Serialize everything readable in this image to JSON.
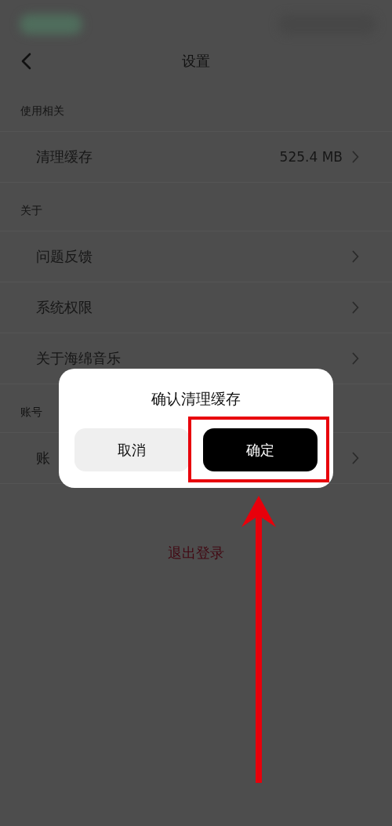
{
  "header": {
    "title": "设置"
  },
  "sections": [
    {
      "title": "使用相关",
      "items": [
        {
          "label": "清理缓存",
          "value": "525.4 MB"
        }
      ]
    },
    {
      "title": "关于",
      "items": [
        {
          "label": "问题反馈"
        },
        {
          "label": "系统权限"
        },
        {
          "label": "关于海绵音乐"
        }
      ]
    },
    {
      "title": "账号",
      "items": [
        {
          "label": "账"
        }
      ]
    }
  ],
  "logout": "退出登录",
  "dialog": {
    "title": "确认清理缓存",
    "buttons": [
      {
        "label": "取消",
        "kind": "secondary"
      },
      {
        "label": "确定",
        "kind": "primary"
      }
    ]
  }
}
